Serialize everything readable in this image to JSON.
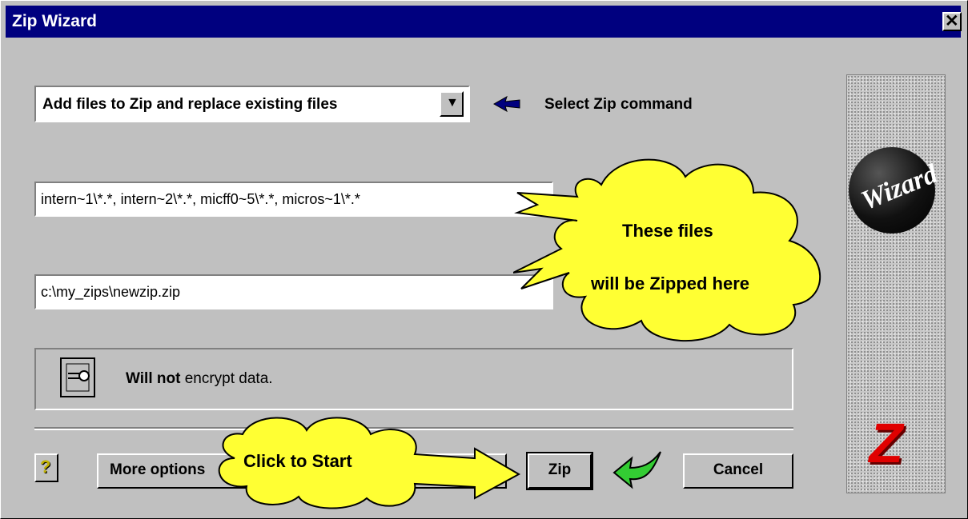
{
  "window": {
    "title": "Zip Wizard"
  },
  "command": {
    "selected": "Add files to Zip and replace existing files",
    "hint": "Select Zip command"
  },
  "files_field": {
    "value": "intern~1\\*.*, intern~2\\*.*, micff0~5\\*.*, micros~1\\*.*"
  },
  "zip_path_field": {
    "value": "c:\\my_zips\\newzip.zip"
  },
  "encryption": {
    "emphasis": "Will not",
    "rest": " encrypt data."
  },
  "buttons": {
    "more_options": "More options",
    "zip": "Zip",
    "cancel": "Cancel",
    "help": "?"
  },
  "callouts": {
    "files_line1": "These files",
    "files_line2": "will be Zipped here",
    "start": "Click to Start"
  },
  "sidebar": {
    "ball_text": "Wizard",
    "logo_letter": "Z"
  },
  "colors": {
    "titlebar": "#00007f",
    "callout": "#ffff33",
    "arrow_green": "#33cc33",
    "logo_red": "#e00000"
  }
}
